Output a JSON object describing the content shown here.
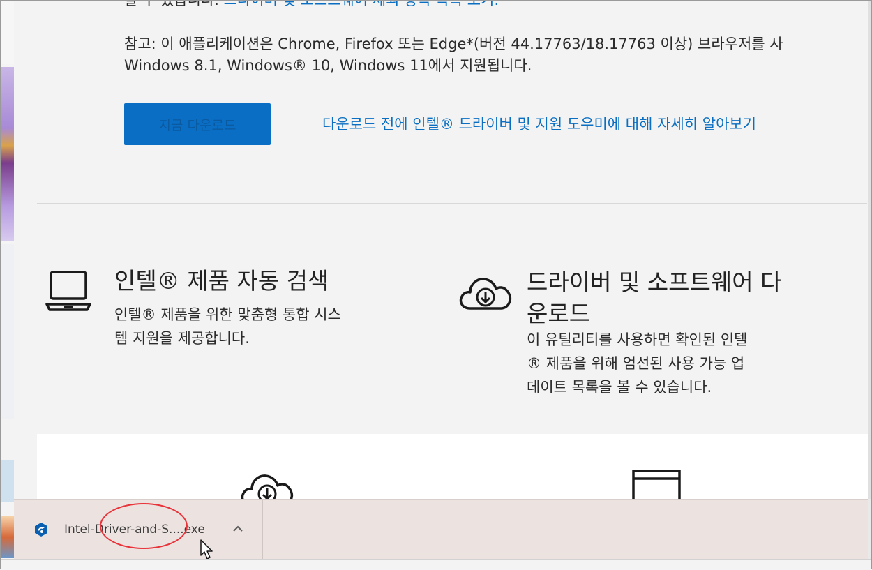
{
  "page": {
    "top_text_prefix": "할 수 있습니다.",
    "top_text_link": "드라이버 및 소프트웨어 제외 항목 목록 보기.",
    "note_line1": "참고: 이 애플리케이션은 Chrome, Firefox 또는 Edge*(버전 44.17763/18.17763 이상) 브라우저를 사",
    "note_line2": "Windows 8.1, Windows® 10, Windows 11에서 지원됩니다.",
    "download_button": "지금 다운로드",
    "learn_more_link": "다운로드 전에 인텔® 드라이버 및 지원 도우미에 대해 자세히 알아보기"
  },
  "features": [
    {
      "icon": "laptop-icon",
      "title": "인텔® 제품 자동 검색",
      "desc_line1": "인텔® 제품을 위한 맞춤형 통합 시스",
      "desc_line2": "템 지원을 제공합니다."
    },
    {
      "icon": "cloud-download-icon",
      "title_line1": "드라이버 및 소프트웨어 다",
      "title_line2": "운로드",
      "desc_line1": "이 유틸리티를 사용하면 확인된 인텔",
      "desc_line2": "® 제품을 위해 엄선된 사용 가능 업",
      "desc_line3": "데이트 목록을 볼 수 있습니다."
    }
  ],
  "bottom_icons": [
    "cloud-download-icon",
    "window-icon"
  ],
  "download_bar": {
    "file_name": "Intel-Driver-and-S....exe",
    "file_icon": "installer-icon",
    "menu_icon": "chevron-up-icon"
  },
  "colors": {
    "accent": "#0b6ec5",
    "link": "#0a6fc2",
    "annotation": "#e8333a"
  }
}
